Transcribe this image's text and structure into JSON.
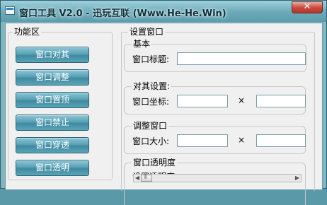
{
  "window": {
    "title": "窗口工具 V2.0 - 迅玩互联 (Www.He-He.Win)",
    "close_label": "✕"
  },
  "left_panel": {
    "title": "功能区",
    "buttons": [
      {
        "label": "窗口对其"
      },
      {
        "label": "窗口调整"
      },
      {
        "label": "窗口置顶"
      },
      {
        "label": "窗口禁止"
      },
      {
        "label": "窗口穿透"
      },
      {
        "label": "窗口透明"
      }
    ]
  },
  "right_panel": {
    "title": "设置窗口",
    "basic": {
      "title": "基本",
      "window_title_label": "窗口标题:",
      "window_title_value": ""
    },
    "align": {
      "title": "对其设置:",
      "coord_label": "窗口坐标:",
      "x_value": "",
      "separator": "×",
      "y_value": ""
    },
    "resize": {
      "title": "调整窗口",
      "size_label": "窗口大小:",
      "width_value": "",
      "separator": "×",
      "height_value": ""
    },
    "opacity": {
      "title": "窗口透明度",
      "label": "设置透明度:",
      "slider_level": 0
    }
  },
  "colors": {
    "frame": "#7fb6c2",
    "button_gradient_mid": "#3f8aa0",
    "close_button": "#c8463a",
    "client_bg": "#f0f0f0"
  }
}
